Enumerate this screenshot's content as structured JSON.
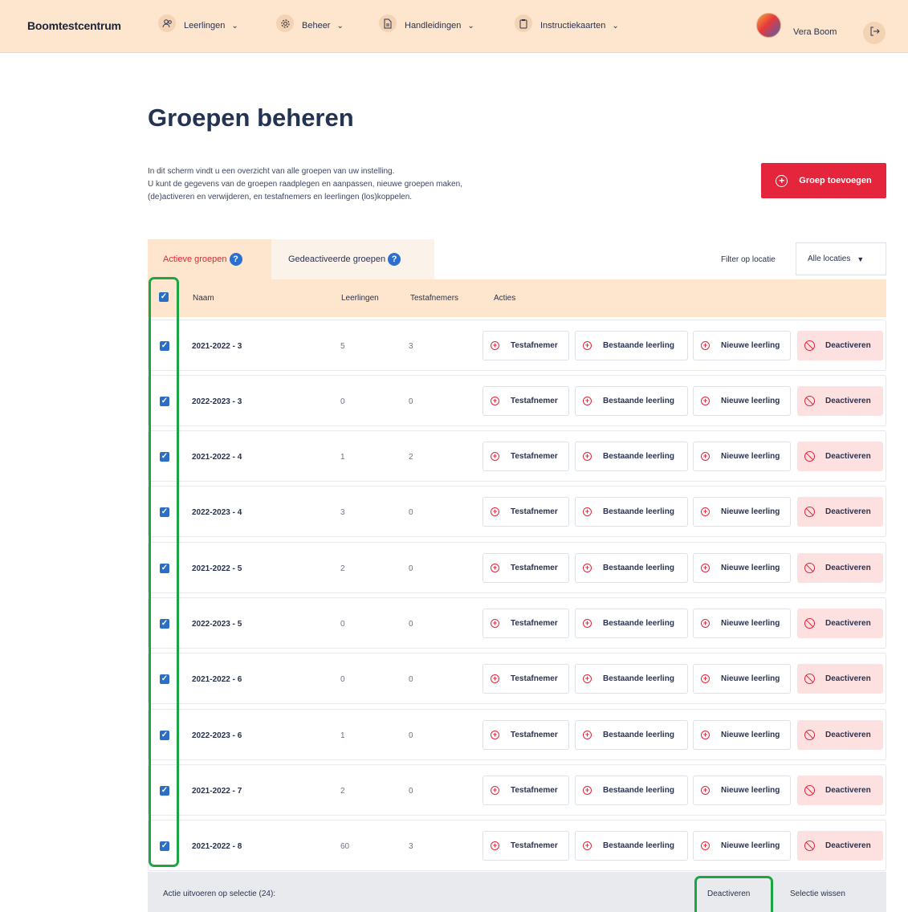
{
  "header": {
    "logo": "Boomtestcentrum",
    "nav": [
      {
        "label": "Leerlingen",
        "icon": "users-icon"
      },
      {
        "label": "Beheer",
        "icon": "gear-icon"
      },
      {
        "label": "Handleidingen",
        "icon": "document-icon"
      },
      {
        "label": "Instructiekaarten",
        "icon": "clipboard-icon"
      }
    ],
    "user_name": "Vera Boom"
  },
  "page": {
    "title": "Groepen beheren",
    "intro": [
      "In dit scherm vindt u een overzicht van alle groepen van uw instelling.",
      "U kunt de gegevens van de groepen raadplegen en aanpassen, nieuwe groepen maken,",
      "(de)activeren en verwijderen, en testafnemers en leerlingen (los)koppelen."
    ],
    "add_button": "Groep toevoegen"
  },
  "tabs": [
    {
      "label": "Actieve groepen",
      "active": true
    },
    {
      "label": "Gedeactiveerde groepen",
      "active": false
    }
  ],
  "filter": {
    "label": "Filter op locatie",
    "value": "Alle locaties"
  },
  "table": {
    "columns": [
      "Naam",
      "Leerlingen",
      "Testafnemers",
      "Acties"
    ],
    "actions": [
      "Testafnemer",
      "Bestaande leerling",
      "Nieuwe leerling",
      "Deactiveren"
    ],
    "rows": [
      {
        "name": "2021-2022 - 3",
        "leerlingen": "5",
        "testafnemers": "3",
        "checked": true
      },
      {
        "name": "2022-2023 - 3",
        "leerlingen": "0",
        "testafnemers": "0",
        "checked": true
      },
      {
        "name": "2021-2022 - 4",
        "leerlingen": "1",
        "testafnemers": "2",
        "checked": true
      },
      {
        "name": "2022-2023 - 4",
        "leerlingen": "3",
        "testafnemers": "0",
        "checked": true
      },
      {
        "name": "2021-2022 - 5",
        "leerlingen": "2",
        "testafnemers": "0",
        "checked": true
      },
      {
        "name": "2022-2023 - 5",
        "leerlingen": "0",
        "testafnemers": "0",
        "checked": true
      },
      {
        "name": "2021-2022 - 6",
        "leerlingen": "0",
        "testafnemers": "0",
        "checked": true
      },
      {
        "name": "2022-2023 - 6",
        "leerlingen": "1",
        "testafnemers": "0",
        "checked": true
      },
      {
        "name": "2021-2022 - 7",
        "leerlingen": "2",
        "testafnemers": "0",
        "checked": true
      },
      {
        "name": "2021-2022 - 8",
        "leerlingen": "60",
        "testafnemers": "3",
        "checked": true
      }
    ]
  },
  "footer": {
    "selection_label": "Actie uitvoeren op selectie (24):",
    "deactivate": "Deactiveren",
    "clear": "Selectie wissen"
  },
  "colors": {
    "accent": "#e4253b",
    "header_bg": "#fde5ce",
    "checkbox": "#2a6ec6",
    "highlight": "#1ea543"
  }
}
